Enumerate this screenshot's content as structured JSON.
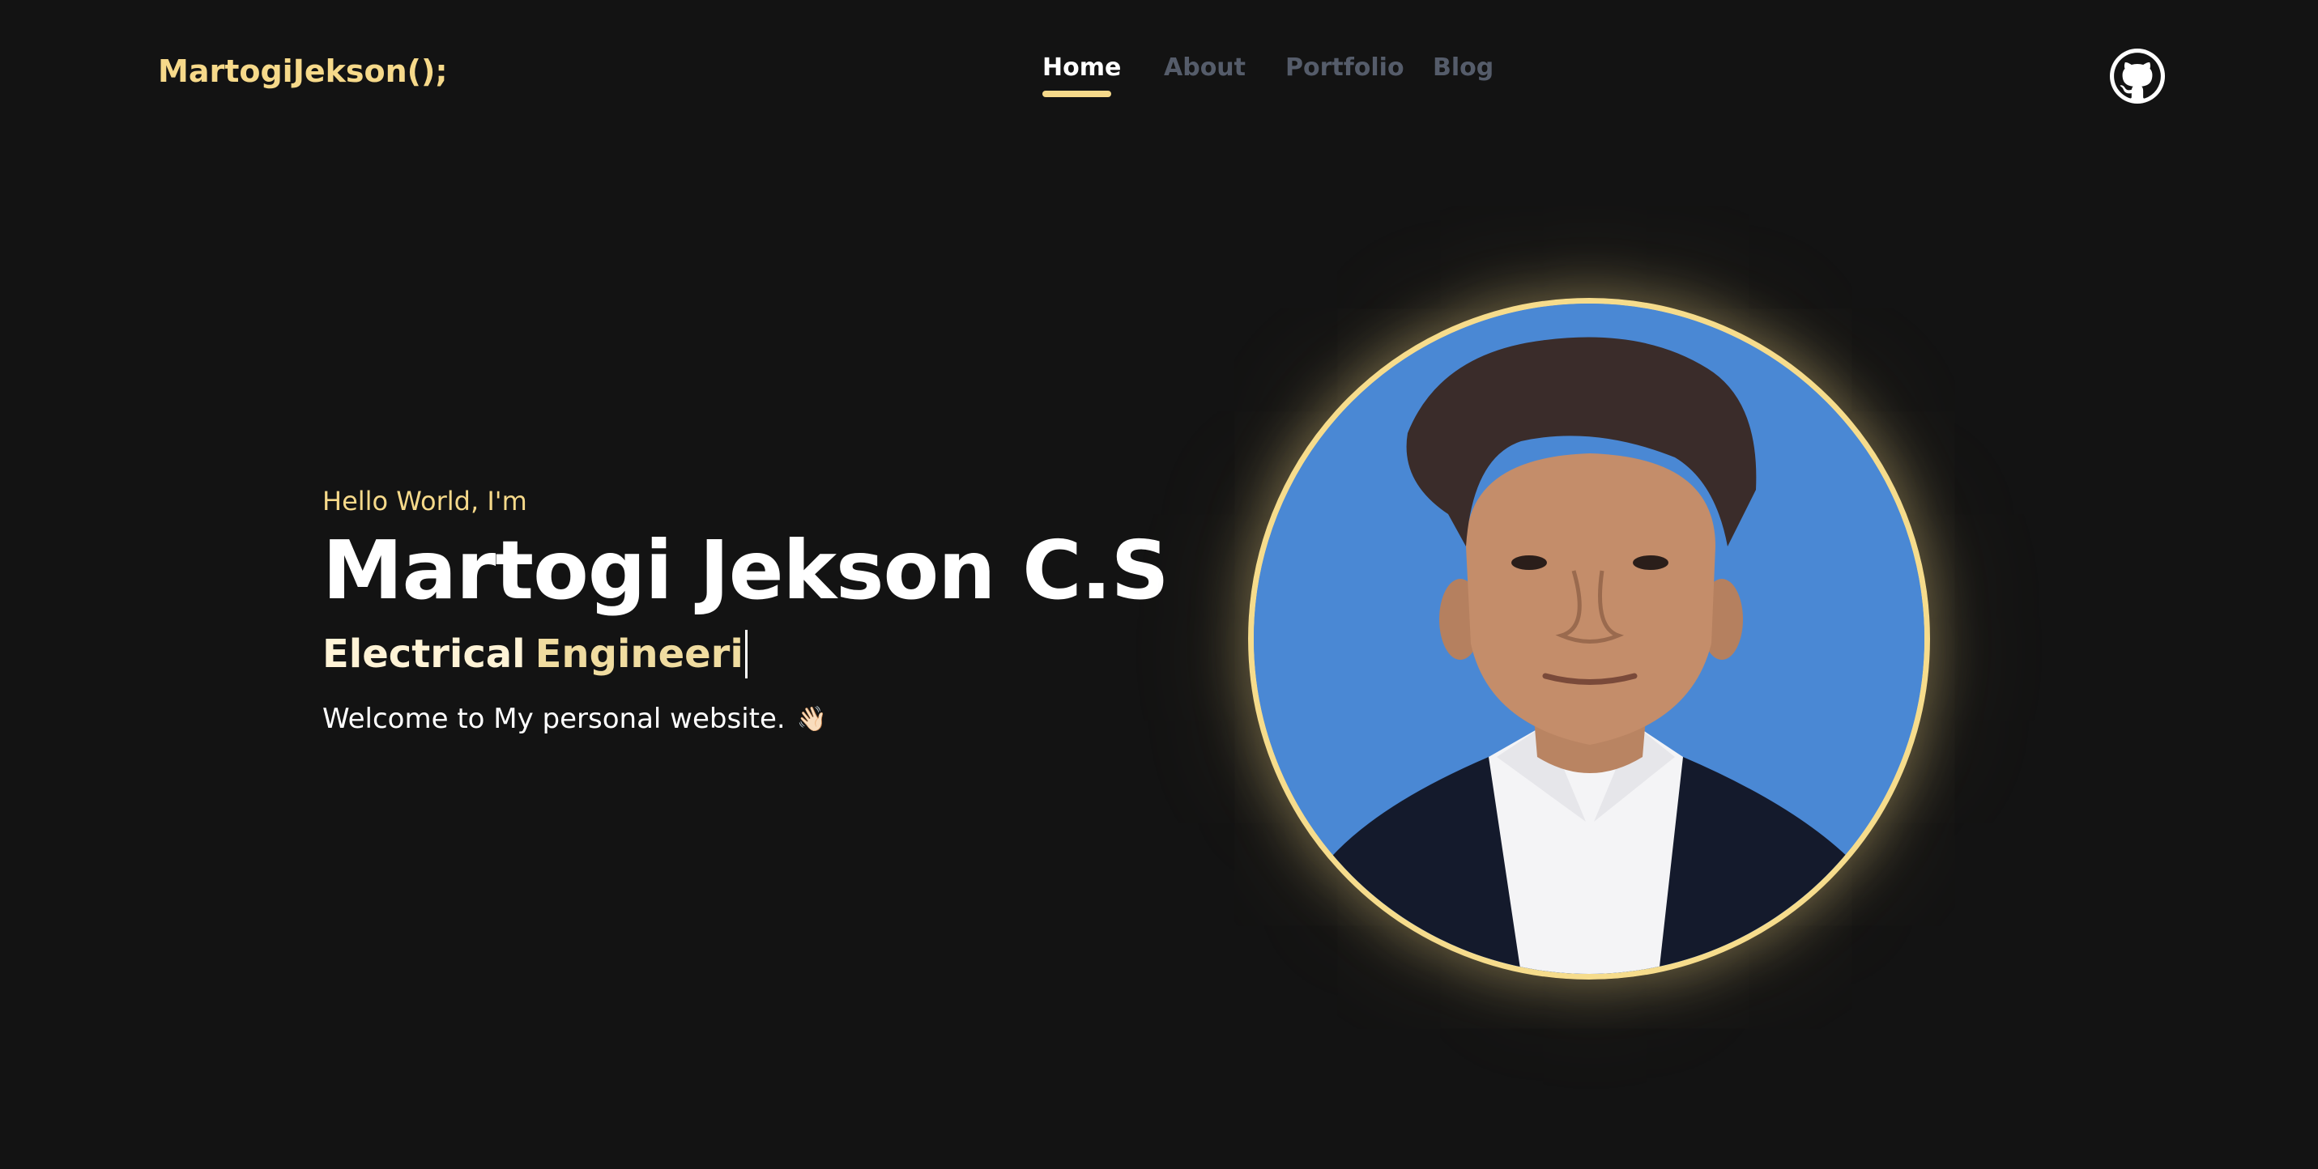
{
  "header": {
    "logo": "MartogiJekson();",
    "nav": [
      {
        "label": "Home",
        "active": true
      },
      {
        "label": "About",
        "active": false
      },
      {
        "label": "Portfolio",
        "active": false
      },
      {
        "label": "Blog",
        "active": false
      }
    ],
    "github_icon": "github-icon"
  },
  "hero": {
    "greeting": "Hello World, I'm",
    "name": "Martogi Jekson C.S",
    "role_part1": "Electrical",
    "role_part2": "Engineeri",
    "welcome": "Welcome to My personal website.",
    "wave_emoji": "👋🏻"
  },
  "colors": {
    "background": "#131313",
    "accent": "#f6d98a",
    "nav_inactive": "#555c6a",
    "portrait_bg": "#4a88d4"
  }
}
